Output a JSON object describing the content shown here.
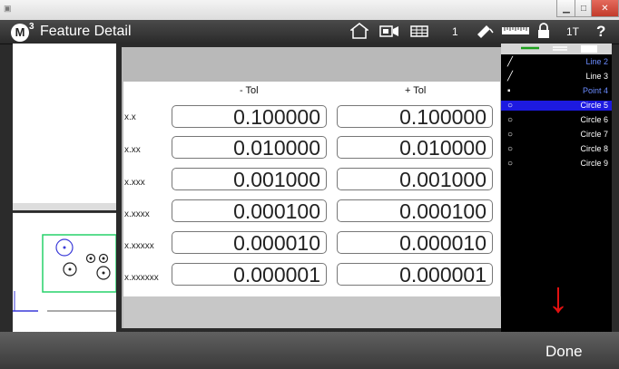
{
  "app": {
    "title": "Feature Detail",
    "logo": "M",
    "logo_sup": "3"
  },
  "toolbar": {
    "home_icon": "home-icon",
    "camera_icon": "camera-icon",
    "grid_icon": "grid-icon",
    "count_label": "1",
    "probe_icon": "probe-icon",
    "ruler_icon": "ruler-icon",
    "lock_icon": "lock-icon",
    "mode_label": "1T",
    "help_label": "?"
  },
  "tolerance_table": {
    "minus_header": "- Tol",
    "plus_header": "+ Tol",
    "rows": [
      {
        "label": "x.x",
        "minus": "0.100000",
        "plus": "0.100000"
      },
      {
        "label": "x.xx",
        "minus": "0.010000",
        "plus": "0.010000"
      },
      {
        "label": "x.xxx",
        "minus": "0.001000",
        "plus": "0.001000"
      },
      {
        "label": "x.xxxx",
        "minus": "0.000100",
        "plus": "0.000100"
      },
      {
        "label": "x.xxxxx",
        "minus": "0.000010",
        "plus": "0.000010"
      },
      {
        "label": "x.xxxxxx",
        "minus": "0.000001",
        "plus": "0.000001"
      }
    ]
  },
  "feature_list": [
    {
      "icon": "line-icon",
      "label": "Line 2",
      "selected": false,
      "highlight": true
    },
    {
      "icon": "line-icon",
      "label": "Line 3",
      "selected": false,
      "highlight": false
    },
    {
      "icon": "point-icon",
      "label": "Point 4",
      "selected": false,
      "highlight": true
    },
    {
      "icon": "circle-icon",
      "label": "Circle 5",
      "selected": true,
      "highlight": false
    },
    {
      "icon": "circle-icon",
      "label": "Circle 6",
      "selected": false,
      "highlight": false
    },
    {
      "icon": "circle-icon",
      "label": "Circle 7",
      "selected": false,
      "highlight": false
    },
    {
      "icon": "circle-icon",
      "label": "Circle 8",
      "selected": false,
      "highlight": false
    },
    {
      "icon": "circle-icon",
      "label": "Circle 9",
      "selected": false,
      "highlight": false
    }
  ],
  "footer": {
    "done_label": "Done"
  },
  "colors": {
    "accent_selected": "#1d1ae0",
    "arrow": "#e21111",
    "preview_green": "#26d26a"
  }
}
